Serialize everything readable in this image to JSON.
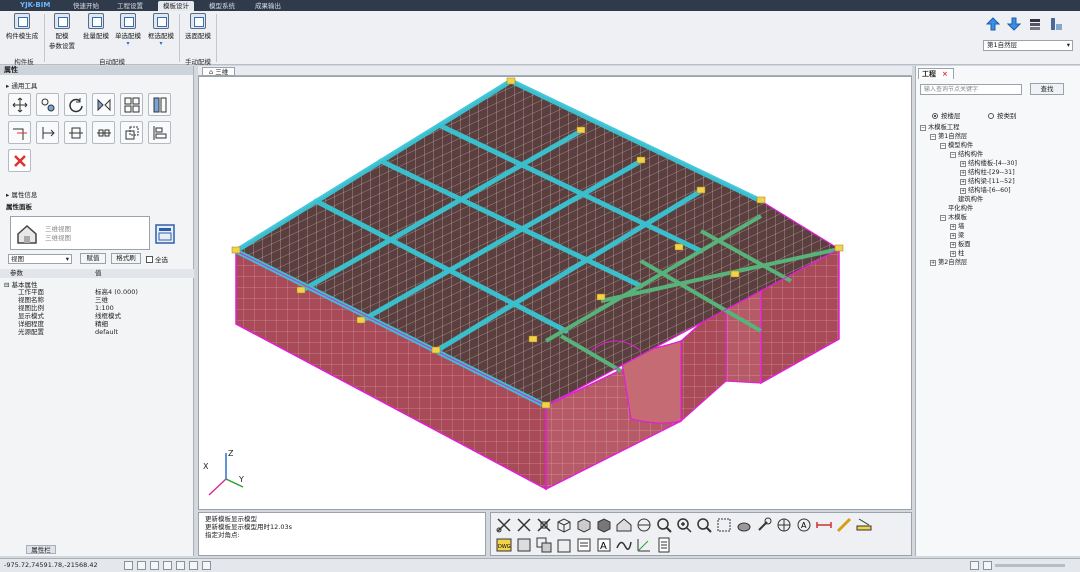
{
  "app": {
    "brand": "YJK-BIM"
  },
  "menu": {
    "tabs": [
      "快速开始",
      "工程设置",
      "模板设计",
      "模型系统",
      "成果输出"
    ],
    "active_index": 2
  },
  "ribbon": {
    "buttons": [
      {
        "label": "构件模生成",
        "sub": ""
      },
      {
        "label": "配模",
        "sub": "参数设置"
      },
      {
        "label": "批量配模",
        "sub": ""
      },
      {
        "label": "单选配模",
        "sub": "▾"
      },
      {
        "label": "框选配模",
        "sub": "▾"
      },
      {
        "label": "选面配模",
        "sub": ""
      }
    ],
    "groups": [
      "构件板",
      "自动配模",
      "手动配模"
    ],
    "layer_select": "第1自然层"
  },
  "left_panel": {
    "title": "属性",
    "section_tools": "通用工具",
    "section_info": "属性信息",
    "sub_panel": "属性面板",
    "view_lines": [
      "三维视图",
      "三维视图"
    ],
    "view_select": "视图",
    "btn_apply": "赋值",
    "btn_format": "格式刷",
    "checkbox_all": "全选",
    "table_header": {
      "param": "参数",
      "value": "值"
    },
    "group": "基本属性",
    "rows": [
      {
        "k": "工作平面",
        "v": "标高4 (0.000)"
      },
      {
        "k": "视图名称",
        "v": "三维"
      },
      {
        "k": "视图比例",
        "v": "1:100"
      },
      {
        "k": "显示模式",
        "v": "线框模式"
      },
      {
        "k": "详细程度",
        "v": "精细"
      },
      {
        "k": "光源配置",
        "v": "default"
      }
    ],
    "bottom_tab": "属性栏"
  },
  "viewport": {
    "tab_label": "三维"
  },
  "console": {
    "lines": [
      "更新模板显示模型",
      "更新模板显示模型用时12.03s",
      "指定对角点:"
    ]
  },
  "project_panel": {
    "tab": "工程",
    "search_placeholder": "输入查询节点关键字",
    "search_btn": "查找",
    "radio_layer": "按楼层",
    "radio_type": "按类别",
    "tree": [
      {
        "level": 0,
        "toggle": "−",
        "label": "木模板工程"
      },
      {
        "level": 1,
        "toggle": "−",
        "label": "第1自然层"
      },
      {
        "level": 2,
        "toggle": "−",
        "label": "模型构件"
      },
      {
        "level": 3,
        "toggle": "−",
        "label": "结构构件"
      },
      {
        "level": 4,
        "toggle": "+",
        "label": "结构楼板-[4--30]"
      },
      {
        "level": 4,
        "toggle": "+",
        "label": "结构柱-[29--31]"
      },
      {
        "level": 4,
        "toggle": "+",
        "label": "结构梁-[11--52]"
      },
      {
        "level": 4,
        "toggle": "+",
        "label": "结构墙-[6--60]"
      },
      {
        "level": 3,
        "toggle": "",
        "label": "建筑构件"
      },
      {
        "level": 2,
        "toggle": "",
        "label": "平化构件"
      },
      {
        "level": 2,
        "toggle": "−",
        "label": "木模板"
      },
      {
        "level": 3,
        "toggle": "+",
        "label": "墙"
      },
      {
        "level": 3,
        "toggle": "+",
        "label": "梁"
      },
      {
        "level": 3,
        "toggle": "+",
        "label": "板面"
      },
      {
        "level": 3,
        "toggle": "+",
        "label": "柱"
      },
      {
        "level": 1,
        "toggle": "+",
        "label": "第2自然层"
      }
    ]
  },
  "status": {
    "coords": "-975.72,74591.78,-21568.42"
  },
  "colors": {
    "slab_top": "#5b3f3f",
    "grid": "#e9d5d5",
    "beam": "#38c6d4",
    "wall_side": "#a84a58",
    "wall_edge": "#e21fd8",
    "green_beam": "#58b37a"
  }
}
